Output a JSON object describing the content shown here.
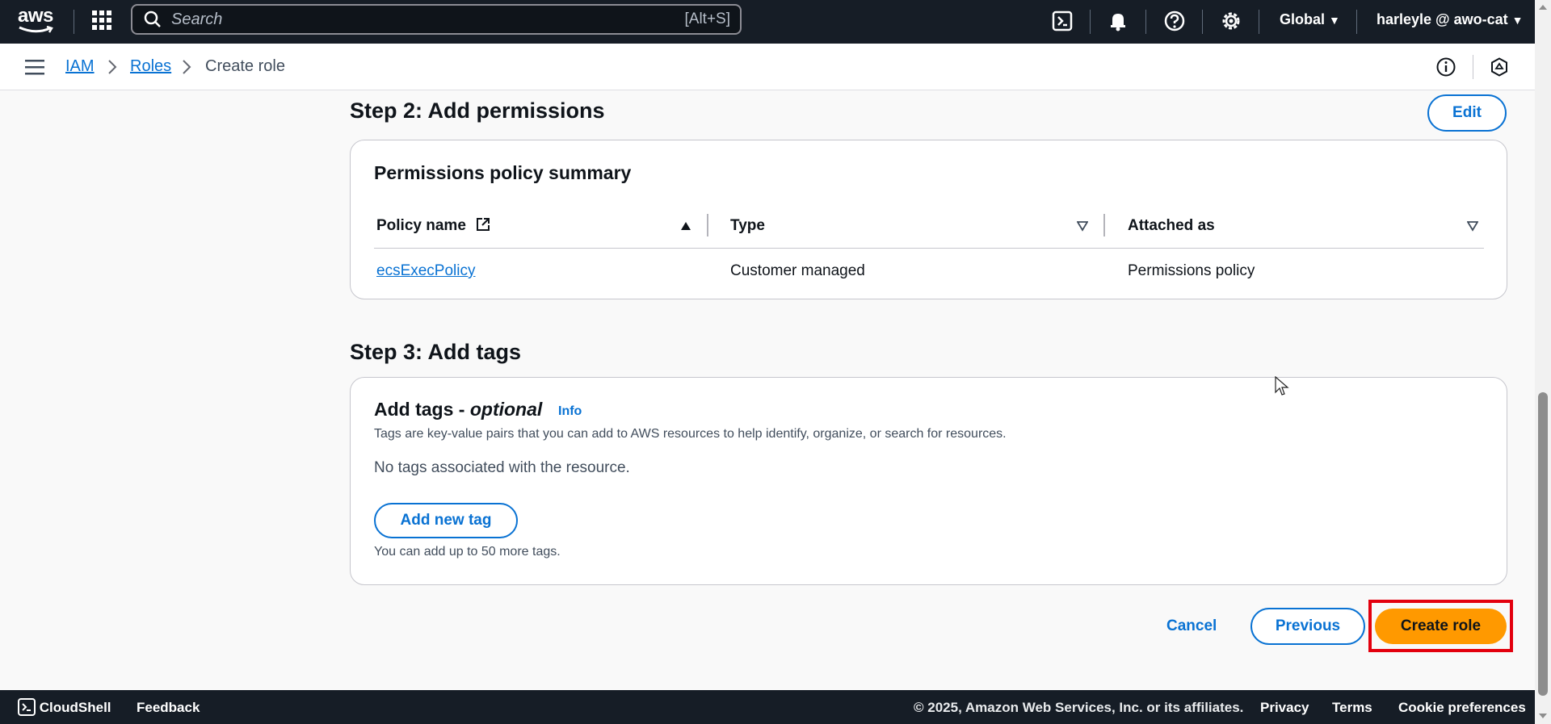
{
  "topnav": {
    "logo_text": "aws",
    "search_placeholder": "Search",
    "search_shortcut": "[Alt+S]",
    "region": "Global",
    "account": "harleyle @ awo-cat"
  },
  "breadcrumb": {
    "items": [
      "IAM",
      "Roles",
      "Create role"
    ]
  },
  "step2": {
    "heading": "Step 2: Add permissions",
    "edit_label": "Edit",
    "card_title": "Permissions policy summary",
    "columns": [
      "Policy name",
      "Type",
      "Attached as"
    ],
    "rows": [
      {
        "policy_name": "ecsExecPolicy",
        "type": "Customer managed",
        "attached_as": "Permissions policy"
      }
    ]
  },
  "step3": {
    "heading": "Step 3: Add tags",
    "card_title_prefix": "Add tags - ",
    "card_title_optional": "optional",
    "info_label": "Info",
    "description": "Tags are key-value pairs that you can add to AWS resources to help identify, organize, or search for resources.",
    "empty_text": "No tags associated with the resource.",
    "add_tag_label": "Add new tag",
    "limit_text": "You can add up to 50 more tags."
  },
  "actions": {
    "cancel_label": "Cancel",
    "previous_label": "Previous",
    "create_label": "Create role"
  },
  "footer": {
    "cloudshell": "CloudShell",
    "feedback": "Feedback",
    "copyright": "© 2025, Amazon Web Services, Inc. or its affiliates.",
    "privacy": "Privacy",
    "terms": "Terms",
    "cookie": "Cookie preferences"
  },
  "colors": {
    "primary": "#ff9900",
    "link": "#0972d3",
    "nav_bg": "#161d26",
    "highlight": "#e3000e"
  }
}
